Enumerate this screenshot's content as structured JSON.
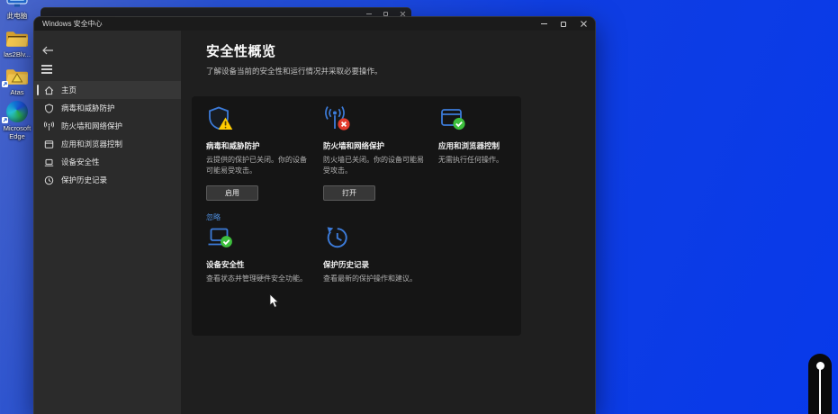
{
  "desktop": {
    "icons": [
      {
        "label": "此电脑"
      },
      {
        "label": "las2Blv..."
      },
      {
        "label": "Atas"
      },
      {
        "label": "Microsoft Edge"
      }
    ]
  },
  "security_app": {
    "title": "Windows 安全中心",
    "nav": {
      "items": [
        {
          "label": "主页"
        },
        {
          "label": "病毒和威胁防护"
        },
        {
          "label": "防火墙和网络保护"
        },
        {
          "label": "应用和浏览器控制"
        },
        {
          "label": "设备安全性"
        },
        {
          "label": "保护历史记录"
        }
      ]
    },
    "page": {
      "title": "安全性概览",
      "subtitle": "了解设备当前的安全性和运行情况并采取必要操作。",
      "tiles": [
        {
          "title": "病毒和威胁防护",
          "desc": "云提供的保护已关闭。你的设备可能易受攻击。",
          "button": "启用",
          "link": "忽略",
          "status": "warning"
        },
        {
          "title": "防火墙和网络保护",
          "desc": "防火墙已关闭。你的设备可能易受攻击。",
          "button": "打开",
          "status": "error"
        },
        {
          "title": "应用和浏览器控制",
          "desc": "无需执行任何操作。",
          "status": "ok"
        },
        {
          "title": "设备安全性",
          "desc": "查看状态并管理硬件安全功能。",
          "status": "ok"
        },
        {
          "title": "保护历史记录",
          "desc": "查看最新的保护操作和建议。",
          "status": "info"
        }
      ]
    },
    "colors": {
      "accent_blue": "#3c7bd9",
      "ok_green": "#3dbf3d",
      "warn_yellow": "#ffcc00",
      "error_red": "#e23b2e",
      "link_blue": "#4f8fe0"
    }
  }
}
